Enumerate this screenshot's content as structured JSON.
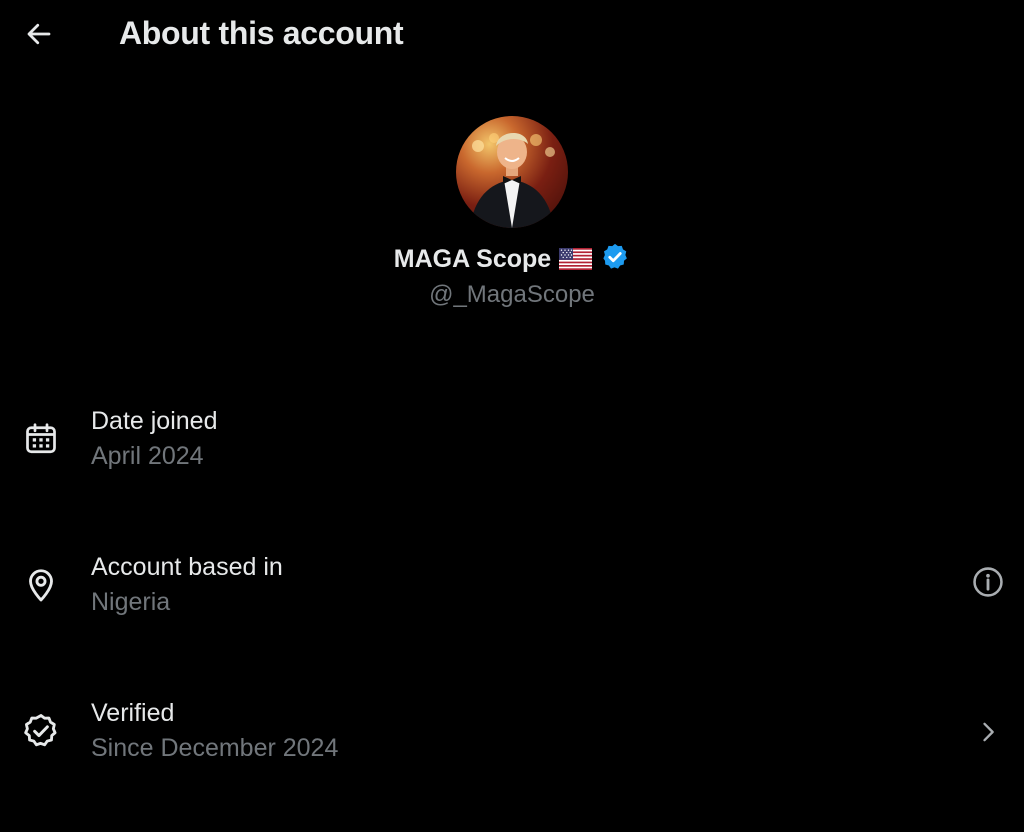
{
  "header": {
    "back_icon": "arrow-left-icon",
    "title": "About this account"
  },
  "profile": {
    "display_name": "MAGA Scope",
    "flag_icon": "us-flag-icon",
    "verified_icon": "verified-badge-icon",
    "handle": "@_MagaScope"
  },
  "info": [
    {
      "icon": "calendar-icon",
      "label": "Date joined",
      "value": "April 2024"
    },
    {
      "icon": "location-pin-icon",
      "label": "Account based in",
      "value": "Nigeria",
      "trailing_icon": "info-icon"
    },
    {
      "icon": "verified-check-icon",
      "label": "Verified",
      "value": "Since December 2024",
      "trailing_icon": "chevron-right-icon"
    }
  ],
  "colors": {
    "background": "#000000",
    "primary_text": "#e7e9ea",
    "secondary_text": "#71767b",
    "verified_blue": "#1d9bf0"
  }
}
